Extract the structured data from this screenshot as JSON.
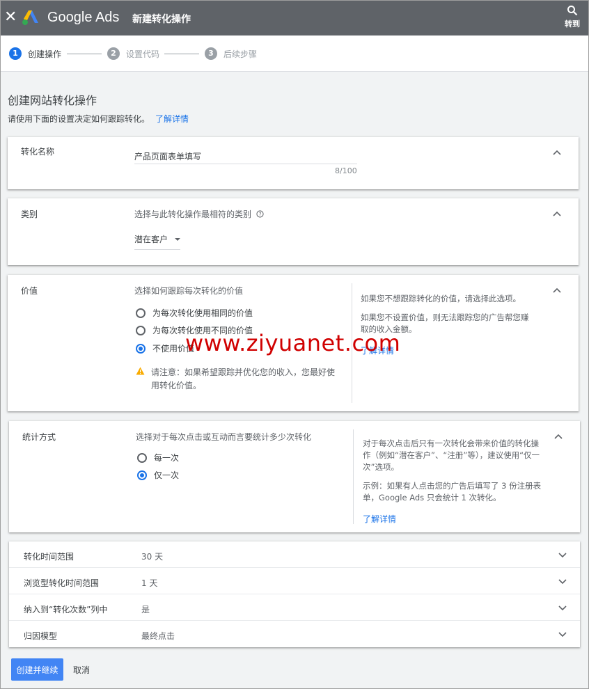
{
  "header": {
    "close_icon": "close-icon",
    "brand": "Google Ads",
    "title": "新建转化操作",
    "goto_label": "转到",
    "colors": {
      "bar": "#5f6368",
      "logo_blue": "#4285f4",
      "logo_yellow": "#fbbc04",
      "logo_green": "#34a853"
    }
  },
  "stepper": {
    "steps": [
      {
        "num": "1",
        "label": "创建操作",
        "active": true
      },
      {
        "num": "2",
        "label": "设置代码",
        "active": false
      },
      {
        "num": "3",
        "label": "后续步骤",
        "active": false
      }
    ]
  },
  "page": {
    "title": "创建网站转化操作",
    "description": "请使用下面的设置决定如何跟踪转化。",
    "learn_more": "了解详情"
  },
  "conversion_name": {
    "label": "转化名称",
    "value": "产品页面表单填写",
    "counter": "8/100"
  },
  "category": {
    "label": "类别",
    "hint": "选择与此转化操作最相符的类别",
    "help_icon": "help-circle-icon",
    "selected": "潜在客户"
  },
  "value": {
    "label": "价值",
    "hint": "选择如何跟踪每次转化的价值",
    "options": [
      {
        "label": "为每次转化使用相同的价值",
        "checked": false
      },
      {
        "label": "为每次转化使用不同的价值",
        "checked": false
      },
      {
        "label": "不使用价值",
        "checked": true
      }
    ],
    "warning_icon": "warning-icon",
    "warning": "请注意：如果希望跟踪并优化您的收入，您最好使用转化价值。",
    "side_text_1": "如果您不想跟踪转化的价值，请选择此选项。",
    "side_text_2": "如果您不设置价值，则无法跟踪您的广告帮您赚取的收入金额。",
    "side_link": "了解详情"
  },
  "count": {
    "label": "统计方式",
    "hint": "选择对于每次点击或互动而言要统计多少次转化",
    "options": [
      {
        "label": "每一次",
        "checked": false
      },
      {
        "label": "仅一次",
        "checked": true
      }
    ],
    "side_text_1": "对于每次点击后只有一次转化会带来价值的转化操作（例如“潜在客户”、“注册”等），建议使用“仅一次”选项。",
    "side_text_2": "示例：如果有人点击您的广告后填写了 3 份注册表单，Google Ads 只会统计 1 次转化。",
    "side_link": "了解详情"
  },
  "settings_rows": [
    {
      "label": "转化时间范围",
      "value": "30 天"
    },
    {
      "label": "浏览型转化时间范围",
      "value": "1 天"
    },
    {
      "label": "纳入到“转化次数”列中",
      "value": "是"
    },
    {
      "label": "归因模型",
      "value": "最终点击"
    }
  ],
  "actions": {
    "primary": "创建并继续",
    "cancel": "取消"
  },
  "watermark": "www.ziyuanet.com"
}
